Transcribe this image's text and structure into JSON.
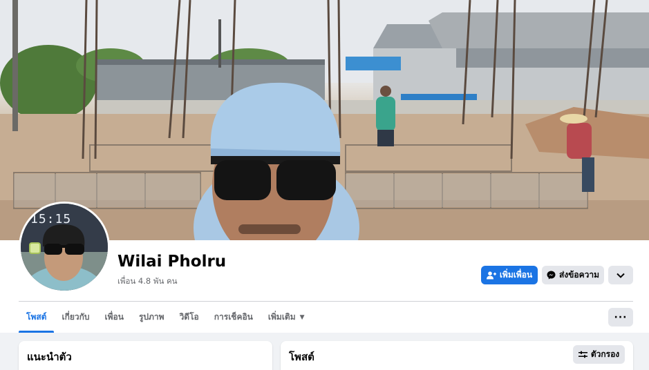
{
  "profile": {
    "name": "Wilai Pholru",
    "friends": "เพื่อน 4.8 พัน คน",
    "avatar_clock": "15:15"
  },
  "actions": {
    "add_friend": "เพิ่มเพื่อน",
    "message": "ส่งข้อความ"
  },
  "tabs": [
    {
      "label": "โพสต์",
      "active": true
    },
    {
      "label": "เกี่ยวกับ"
    },
    {
      "label": "เพื่อน"
    },
    {
      "label": "รูปภาพ"
    },
    {
      "label": "วิดีโอ"
    },
    {
      "label": "การเช็คอิน"
    },
    {
      "label": "เพิ่มเติม"
    }
  ],
  "cards": {
    "intro_title": "แนะนำตัว",
    "posts_title": "โพสต์",
    "filter_label": "ตัวกรอง"
  },
  "colors": {
    "accent": "#1b74e4",
    "background": "#f0f2f5",
    "button_gray": "#e4e6eb"
  },
  "icons": [
    "add-friend-icon",
    "messenger-icon",
    "chevron-down-icon",
    "more-dots-icon",
    "filter-icon",
    "caret-down-icon"
  ]
}
